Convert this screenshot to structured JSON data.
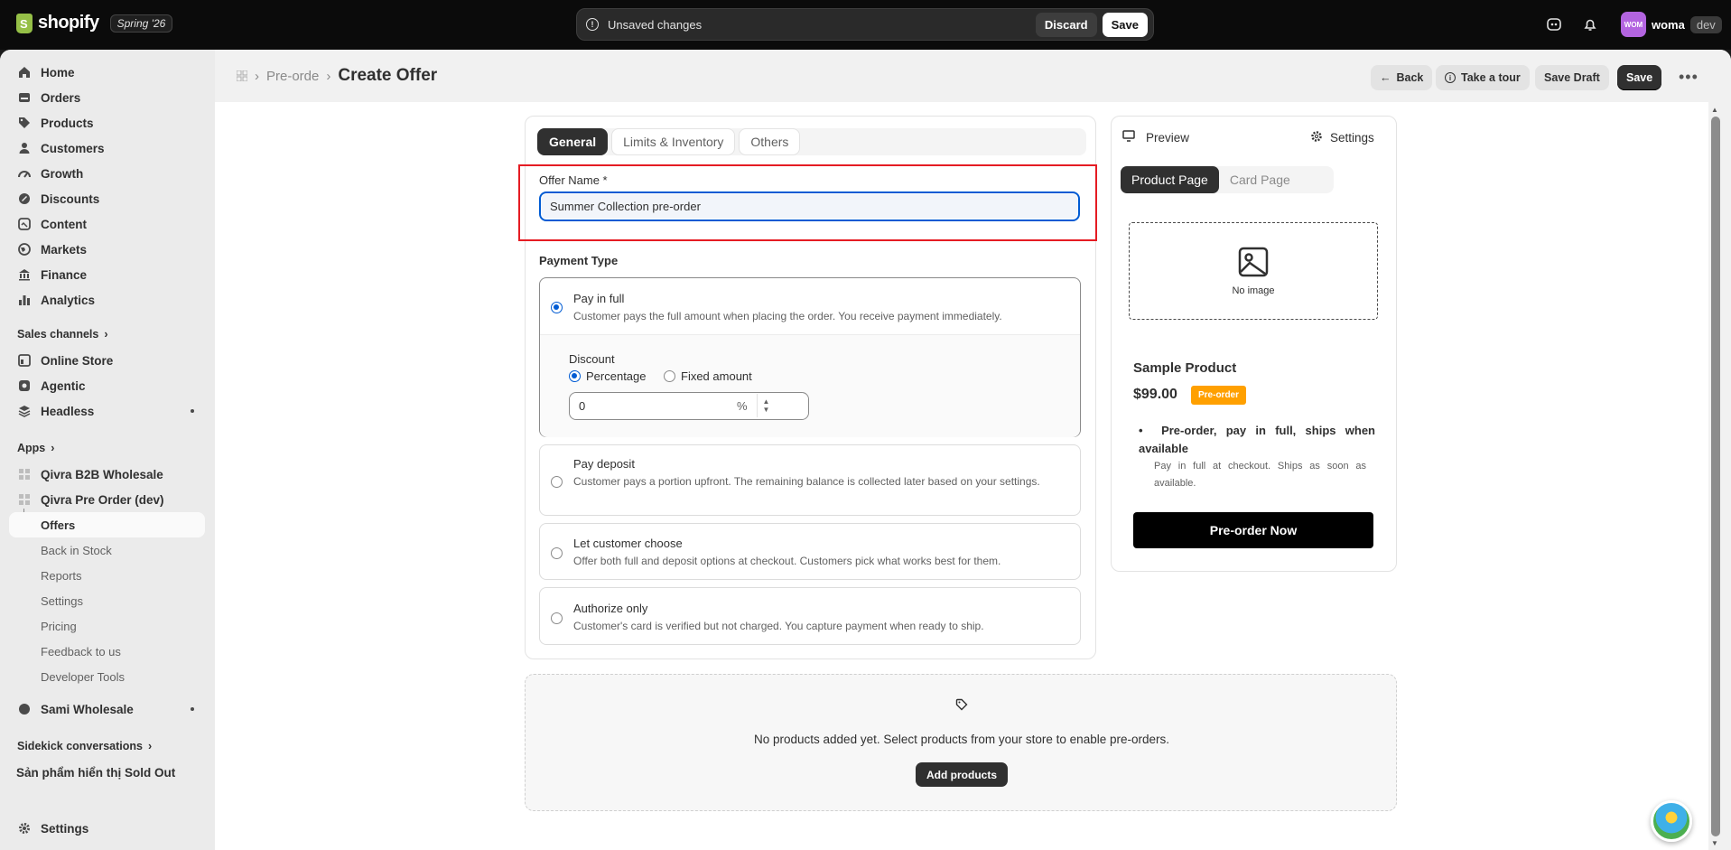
{
  "topbar": {
    "brand": "shopify",
    "edition_badge": "Spring '26",
    "unsaved_message": "Unsaved changes",
    "discard_label": "Discard",
    "save_label": "Save",
    "user_initials": "WOM",
    "user_name": "woma",
    "env_badge": "dev"
  },
  "sidebar": {
    "main_items": [
      {
        "label": "Home",
        "icon": "home-icon"
      },
      {
        "label": "Orders",
        "icon": "orders-icon"
      },
      {
        "label": "Products",
        "icon": "tag-icon"
      },
      {
        "label": "Customers",
        "icon": "person-icon"
      },
      {
        "label": "Growth",
        "icon": "gauge-icon"
      },
      {
        "label": "Discounts",
        "icon": "discount-icon"
      },
      {
        "label": "Content",
        "icon": "content-icon"
      },
      {
        "label": "Markets",
        "icon": "globe-icon"
      },
      {
        "label": "Finance",
        "icon": "bank-icon"
      },
      {
        "label": "Analytics",
        "icon": "bar-chart-icon"
      }
    ],
    "sales_channels_label": "Sales channels",
    "channels": [
      {
        "label": "Online Store",
        "icon": "store-icon"
      },
      {
        "label": "Agentic",
        "icon": "agentic-icon"
      },
      {
        "label": "Headless",
        "icon": "headless-icon"
      }
    ],
    "apps_label": "Apps",
    "apps": [
      {
        "label": "Qivra B2B Wholesale"
      },
      {
        "label": "Qivra Pre Order (dev)"
      }
    ],
    "app_sub_items": [
      "Offers",
      "Back in Stock",
      "Reports",
      "Settings",
      "Pricing",
      "Feedback to us",
      "Developer Tools"
    ],
    "other_app": "Sami Wholesale",
    "sidekick_label": "Sidekick conversations",
    "sidekick_item": "Sản phẩm hiển thị Sold Out",
    "settings_label": "Settings"
  },
  "header": {
    "breadcrumb_parent": "Pre-orde",
    "title": "Create Offer",
    "back_label": "Back",
    "tour_label": "Take a tour",
    "save_draft_label": "Save Draft",
    "save_label": "Save"
  },
  "form": {
    "tabs": [
      "General",
      "Limits & Inventory",
      "Others"
    ],
    "offer_name_label": "Offer Name *",
    "offer_name_value": "Summer Collection pre-order",
    "payment_type_label": "Payment Type",
    "payment_options": [
      {
        "title": "Pay in full",
        "desc": "Customer pays the full amount when placing the order. You receive payment immediately."
      },
      {
        "title": "Pay deposit",
        "desc": "Customer pays a portion upfront. The remaining balance is collected later based on your settings."
      },
      {
        "title": "Let customer choose",
        "desc": "Offer both full and deposit options at checkout. Customers pick what works best for them."
      },
      {
        "title": "Authorize only",
        "desc": "Customer's card is verified but not charged. You capture payment when ready to ship."
      }
    ],
    "discount_label": "Discount",
    "discount_percentage": "Percentage",
    "discount_fixed": "Fixed amount",
    "discount_value": "0",
    "discount_suffix": "%"
  },
  "preview": {
    "preview_label": "Preview",
    "settings_label": "Settings",
    "tabs": [
      "Product Page",
      "Card Page"
    ],
    "no_image": "No image",
    "product_name": "Sample Product",
    "price": "$99.00",
    "badge": "Pre-order",
    "bullet": "Pre-order, pay in full, ships when available",
    "bullet_sub": "Pay in full at checkout. Ships as soon as available.",
    "button": "Pre-order Now"
  },
  "products": {
    "empty_message": "No products added yet. Select products from your store to enable pre-orders.",
    "add_button": "Add products"
  },
  "colors": {
    "accent": "#005bd3",
    "badge": "#ffa000",
    "highlight": "#e51c23",
    "dark": "#303030"
  }
}
